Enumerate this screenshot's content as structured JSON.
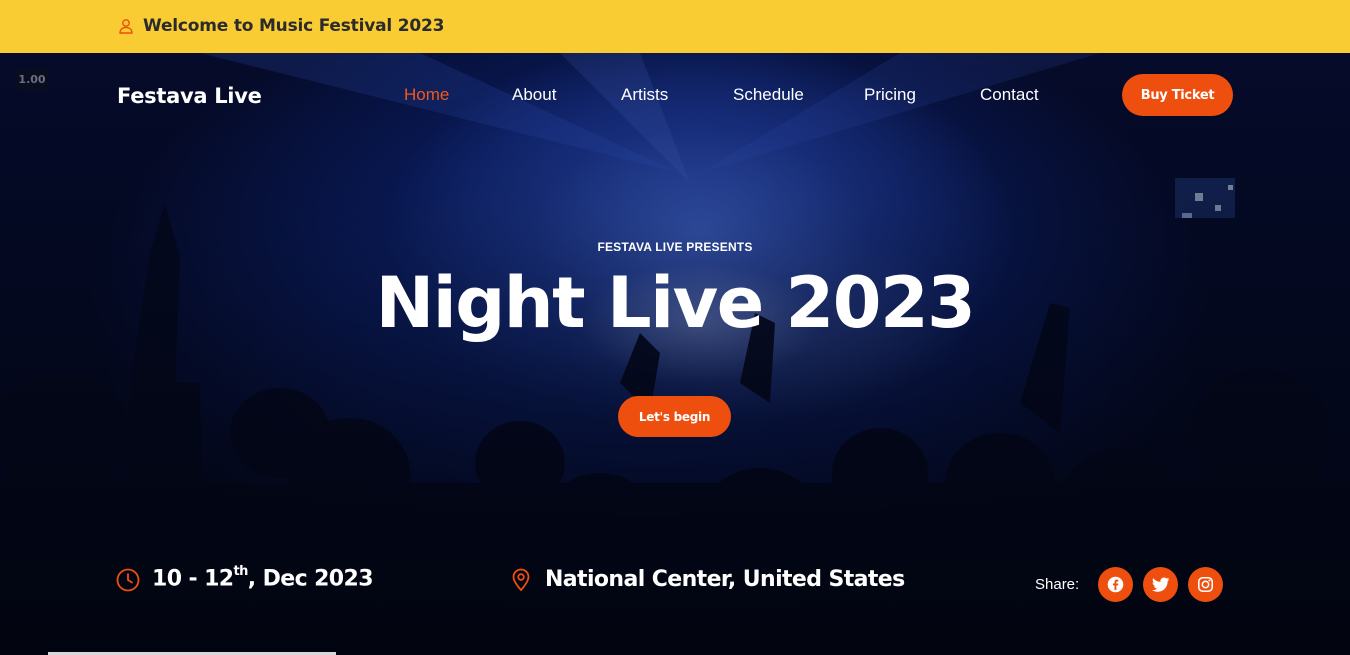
{
  "topbar": {
    "welcome_text": "Welcome to Music Festival 2023",
    "icon": "user-icon",
    "background": "#f8cc32"
  },
  "overlay_badge": "1.00",
  "header": {
    "brand": "Festava Live",
    "nav": [
      {
        "label": "Home",
        "active": true
      },
      {
        "label": "About",
        "active": false
      },
      {
        "label": "Artists",
        "active": false
      },
      {
        "label": "Schedule",
        "active": false
      },
      {
        "label": "Pricing",
        "active": false
      },
      {
        "label": "Contact",
        "active": false
      }
    ],
    "cta_label": "Buy Ticket"
  },
  "hero": {
    "eyebrow": "FESTAVA LIVE PRESENTS",
    "title": "Night Live 2023",
    "button_label": "Let's begin"
  },
  "event_info": {
    "date_main": "10 - 12",
    "date_sup": "th",
    "date_rest": ", Dec 2023",
    "date_icon": "clock-icon",
    "location": "National Center, United States",
    "location_icon": "map-pin-icon",
    "share_label": "Share:",
    "social": [
      "facebook-icon",
      "twitter-icon",
      "instagram-icon"
    ]
  },
  "colors": {
    "accent": "#ee4f0e",
    "topbar": "#f8cc32",
    "hero_dark": "#050b2a"
  }
}
